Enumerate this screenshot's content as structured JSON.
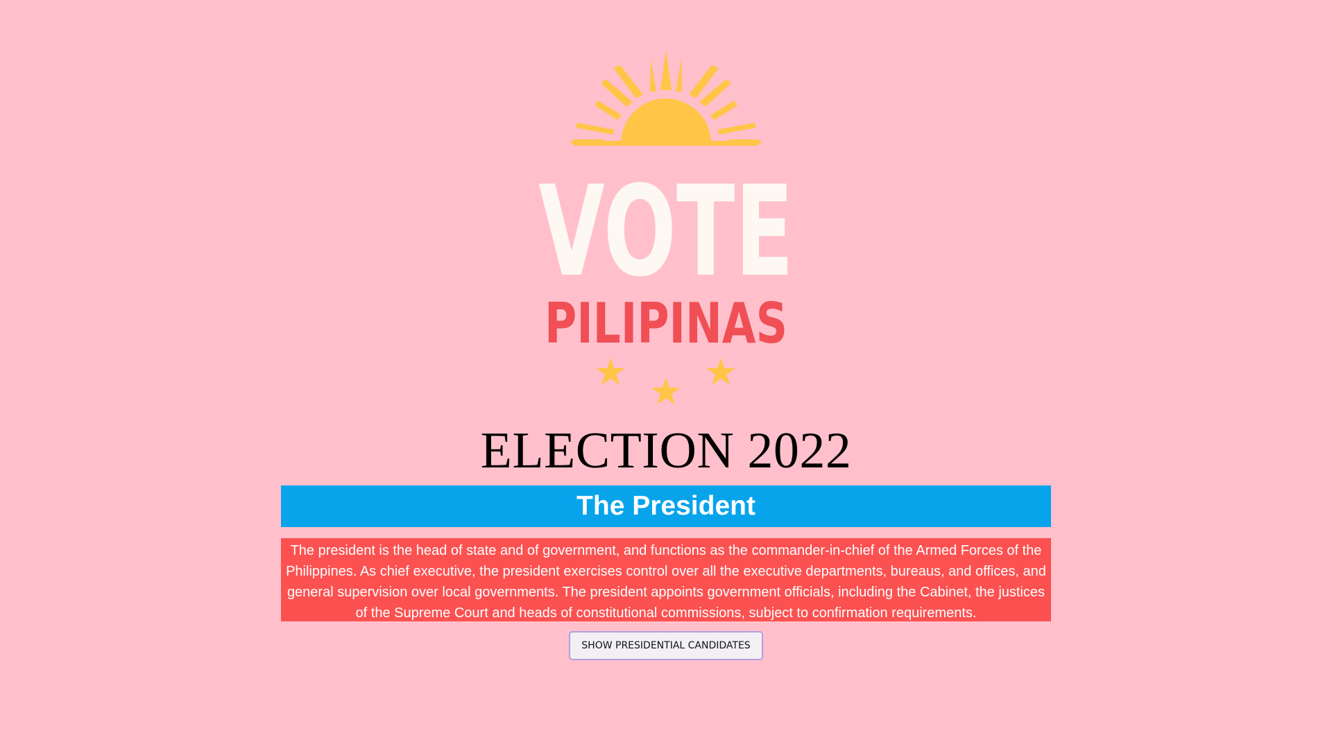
{
  "logo": {
    "word": "VOTE",
    "subword": "PILIPINAS",
    "sun_icon": "sun-icon",
    "star_icon": "star-icon",
    "colors": {
      "sun": "#ffc547",
      "vote": "#fdf8f2",
      "pilipinas": "#ef4f55",
      "stars": "#ffc547"
    }
  },
  "page": {
    "title": "ELECTION 2022",
    "background": "#ffc0cb"
  },
  "section": {
    "heading": "The President",
    "bar_color": "#08a4eb",
    "description": "The president is the head of state and of government, and functions as the commander-in-chief of the Armed Forces of the Philippines. As chief executive, the president exercises control over all the executive departments, bureaus, and offices, and general supervision over local governments. The president appoints government officials, including the Cabinet, the justices of the Supreme Court and heads of constitutional commissions, subject to confirmation requirements.",
    "description_color": "#fb5151"
  },
  "actions": {
    "show_candidates_label": "SHOW PRESIDENTIAL CANDIDATES"
  }
}
